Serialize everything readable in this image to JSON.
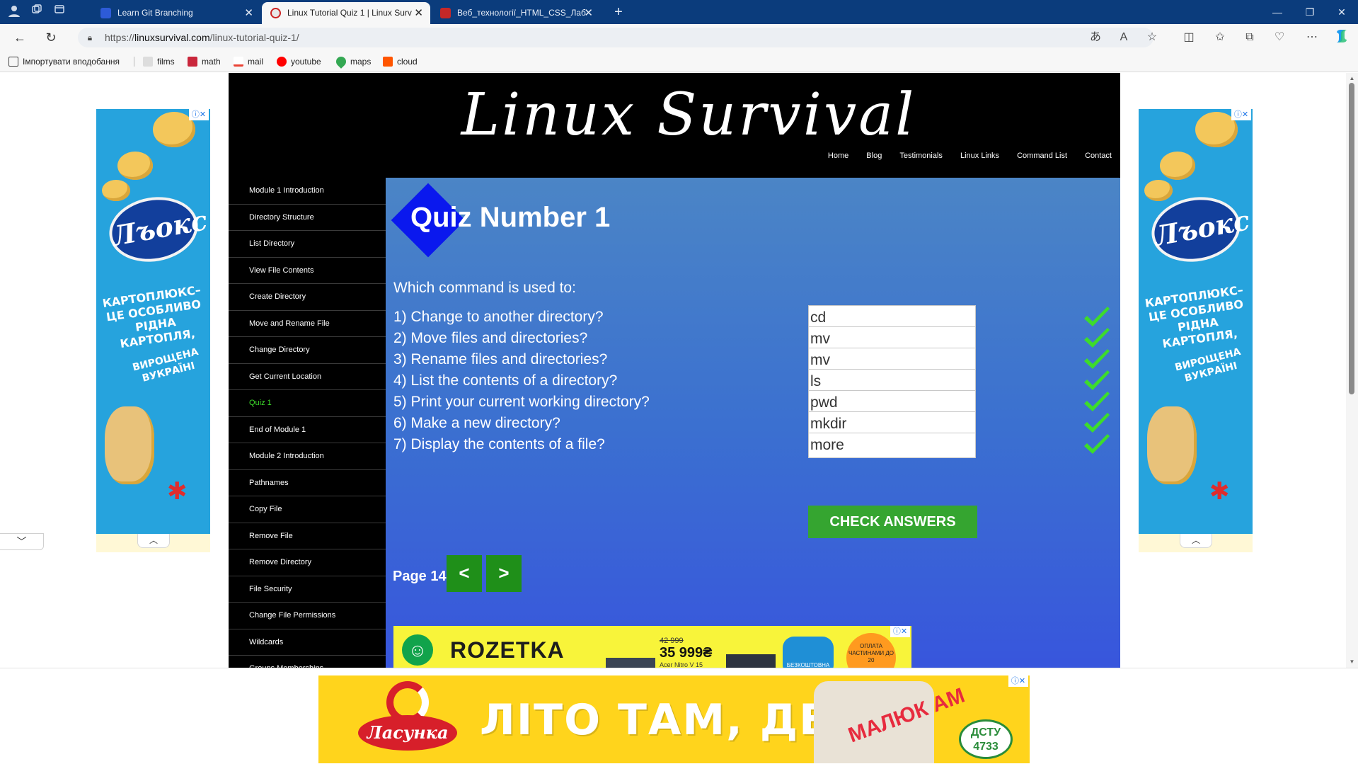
{
  "browser": {
    "tabs": [
      {
        "title": "Learn Git Branching",
        "favicon_color": "#2d5bd8",
        "active": false
      },
      {
        "title": "Linux Tutorial Quiz 1 | Linux Surv",
        "favicon_color": "#e7e7e7",
        "active": true
      },
      {
        "title": "Веб_технології_HTML_CSS_Лаб",
        "favicon_color": "#c62828",
        "active": false
      }
    ],
    "url_prefix": "https://",
    "url_host": "linuxsurvival.com",
    "url_path": "/linux-tutorial-quiz-1/",
    "bookmarks": [
      {
        "label": "Імпортувати вподобання",
        "icon": "import-icon"
      },
      {
        "label": "films",
        "icon": "films-icon"
      },
      {
        "label": "math",
        "icon": "math-icon"
      },
      {
        "label": "mail",
        "icon": "gmail-icon"
      },
      {
        "label": "youtube",
        "icon": "youtube-icon"
      },
      {
        "label": "maps",
        "icon": "maps-icon"
      },
      {
        "label": "cloud",
        "icon": "soundcloud-icon"
      }
    ]
  },
  "site": {
    "logo": "Linux Survival",
    "nav": [
      "Home",
      "Blog",
      "Testimonials",
      "Linux Links",
      "Command List",
      "Contact"
    ],
    "sidebar": [
      {
        "label": "Module 1 Introduction",
        "active": false
      },
      {
        "label": "Directory Structure",
        "active": false
      },
      {
        "label": "List Directory",
        "active": false
      },
      {
        "label": "View File Contents",
        "active": false
      },
      {
        "label": "Create Directory",
        "active": false
      },
      {
        "label": "Move and Rename File",
        "active": false
      },
      {
        "label": "Change Directory",
        "active": false
      },
      {
        "label": "Get Current Location",
        "active": false
      },
      {
        "label": "Quiz 1",
        "active": true
      },
      {
        "label": "End of Module 1",
        "active": false
      },
      {
        "label": "Module 2 Introduction",
        "active": false
      },
      {
        "label": "Pathnames",
        "active": false
      },
      {
        "label": "Copy File",
        "active": false
      },
      {
        "label": "Remove File",
        "active": false
      },
      {
        "label": "Remove Directory",
        "active": false
      },
      {
        "label": "File Security",
        "active": false
      },
      {
        "label": "Change File Permissions",
        "active": false
      },
      {
        "label": "Wildcards",
        "active": false
      },
      {
        "label": "Groups Memberships",
        "active": false
      }
    ],
    "quiz": {
      "title": "Quiz Number 1",
      "intro": "Which command is used to:",
      "questions": [
        {
          "text": "1) Change to another directory?",
          "answer": "cd",
          "correct": true
        },
        {
          "text": "2) Move files and directories?",
          "answer": "mv",
          "correct": true
        },
        {
          "text": "3) Rename files and directories?",
          "answer": "mv",
          "correct": true
        },
        {
          "text": "4) List the contents of a directory?",
          "answer": "ls",
          "correct": true
        },
        {
          "text": "5) Print your current working directory?",
          "answer": "pwd",
          "correct": true
        },
        {
          "text": "6) Make a new directory?",
          "answer": "mkdir",
          "correct": true
        },
        {
          "text": "7) Display the contents of a file?",
          "answer": "more",
          "correct": true
        }
      ],
      "check_label": "CHECK ANSWERS",
      "page_label": "Page 14",
      "prev_label": "<",
      "next_label": ">"
    }
  },
  "ads": {
    "side": {
      "brand": "Лъокс",
      "slogan": "КАРТОПЛЮКС– ЦЕ ОСОБЛИВО РІДНА КАРТОПЛЯ,",
      "slogan2": "ВИРОЩЕНА ВУКРАЇНІ"
    },
    "rozetka": {
      "name": "ROZETKA",
      "old_price": "42 999",
      "price": "35 999₴",
      "model": "Acer Nitro V 15",
      "badge_blue": "БЕЗКОШТОВНА",
      "badge_orange": "ОПЛАТА ЧАСТИНАМИ ДО 20"
    },
    "bottom": {
      "brand": "Ласунка",
      "headline": "ЛІТО ТАМ, ДЕ",
      "product": "МАЛЮК АМ",
      "cert": "ДСТУ 4733"
    }
  },
  "colors": {
    "chrome_blue": "#0b3c7c",
    "content_top": "#4b85c6",
    "content_bottom": "#3855dd",
    "active_sidebar": "#3ddc2b",
    "check_green": "#3ddc2b",
    "button_green": "#35a530"
  }
}
